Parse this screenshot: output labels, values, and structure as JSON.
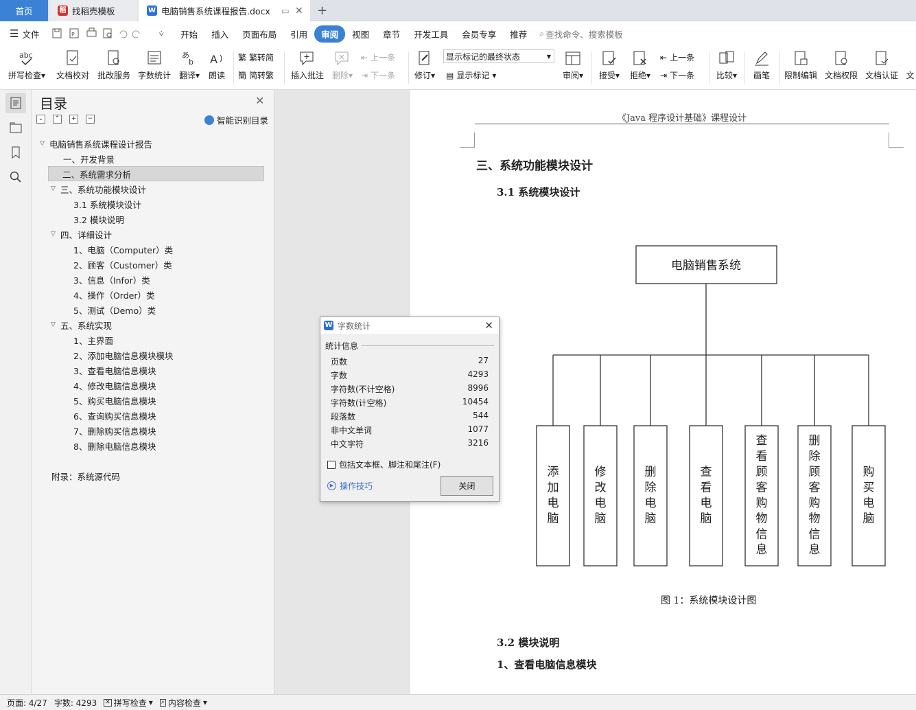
{
  "tabs": {
    "home": "首页",
    "template": "找稻壳模板",
    "document": "电脑销售系统课程报告.docx"
  },
  "menu": {
    "file": "文件",
    "items": [
      "开始",
      "插入",
      "页面布局",
      "引用",
      "审阅",
      "视图",
      "章节",
      "开发工具",
      "会员专享",
      "推荐"
    ],
    "active": "审阅",
    "search": "查找命令、搜索模板"
  },
  "ribbon": {
    "spell": "拼写检查",
    "proof": "文档校对",
    "revise": "批改服务",
    "wordcount": "字数统计",
    "translate": "翻译",
    "read": "朗读",
    "trad2simp": "繁转简",
    "simp2trad": "简转繁",
    "insert_comment": "插入批注",
    "delete": "删除",
    "prev_comment": "上一条",
    "next_comment": "下一条",
    "track": "修订",
    "markup_select": "显示标记的最终状态",
    "show_markup": "显示标记",
    "review": "审阅",
    "accept": "接受",
    "reject": "拒绝",
    "prev": "上一条",
    "next": "下一条",
    "compare": "比较",
    "pen": "画笔",
    "restrict": "限制编辑",
    "permission": "文档权限",
    "certify": "文档认证",
    "more": "文"
  },
  "nav": {
    "title": "目录",
    "smart": "智能识别目录",
    "toc": [
      "电脑销售系统课程设计报告",
      "一、开发背景",
      "二、系统需求分析",
      "三、系统功能模块设计",
      "3.1  系统模块设计",
      "3.2  模块说明",
      "四、详细设计",
      "1、电脑（Computer）类",
      "2、顾客（Customer）类",
      "3、信息（Infor）类",
      "4、操作（Order）类",
      "5、测试（Demo）类",
      "五、系统实现",
      "1、主界面",
      "2、添加电脑信息模块模块",
      "3、查看电脑信息模块",
      "4、修改电脑信息模块",
      "5、购买电脑信息模块",
      "6、查询购买信息模块",
      "7、删除购买信息模块",
      "8、删除电脑信息模块",
      "附录：系统源代码"
    ]
  },
  "doc": {
    "header": "《Java 程序设计基础》课程设计",
    "h3": "三、系统功能模块设计",
    "h31": "3.1  系统模块设计",
    "diagram_root": "电脑销售系统",
    "diagram_children": [
      "添加电脑",
      "修改电脑",
      "删除电脑",
      "查看电脑",
      "查看顾客购物信息",
      "删除顾客购物信息",
      "购买电脑"
    ],
    "caption": "图 1：系统模块设计图",
    "h32": "3.2  模块说明",
    "item1": "1、查看电脑信息模块"
  },
  "dialog": {
    "title": "字数统计",
    "group": "统计信息",
    "stats": [
      {
        "label": "页数",
        "value": "27"
      },
      {
        "label": "字数",
        "value": "4293"
      },
      {
        "label": "字符数(不计空格)",
        "value": "8996"
      },
      {
        "label": "字符数(计空格)",
        "value": "10454"
      },
      {
        "label": "段落数",
        "value": "544"
      },
      {
        "label": "非中文单词",
        "value": "1077"
      },
      {
        "label": "中文字符",
        "value": "3216"
      }
    ],
    "checkbox": "包括文本框、脚注和尾注(F)",
    "tips": "操作技巧",
    "close": "关闭"
  },
  "status": {
    "page": "页面: 4/27",
    "words": "字数: 4293",
    "spell": "拼写检查",
    "content": "内容检查"
  },
  "colors": {
    "accent": "#3b82d6",
    "tpl_icon": "#d6322b"
  }
}
